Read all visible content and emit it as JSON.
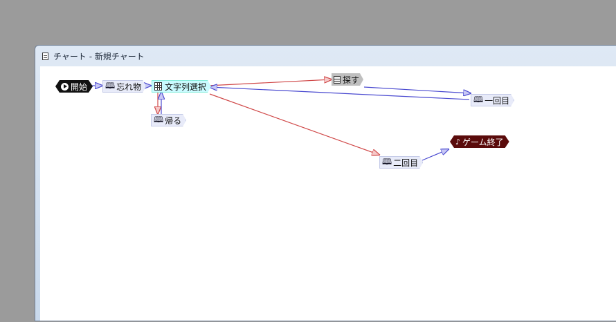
{
  "window": {
    "title": "チャート - 新規チャート"
  },
  "nodes": {
    "start": "開始",
    "forgotten": "忘れ物",
    "select_string": "文字列選択",
    "go_home": "帰る",
    "search": "探す",
    "first_time": "一回目",
    "second_time": "二回目",
    "game_over": "ゲーム終了"
  },
  "icons": {
    "title": "document-icon",
    "start": "play-icon",
    "book": "book-icon",
    "select": "grid-icon",
    "search": "calculator-icon",
    "end": "music-note-icon"
  },
  "colors": {
    "edge_blue": "#4a4ad0",
    "edge_red": "#d04848",
    "canvas": "#ffffff",
    "desktop": "#9b9b9b"
  }
}
